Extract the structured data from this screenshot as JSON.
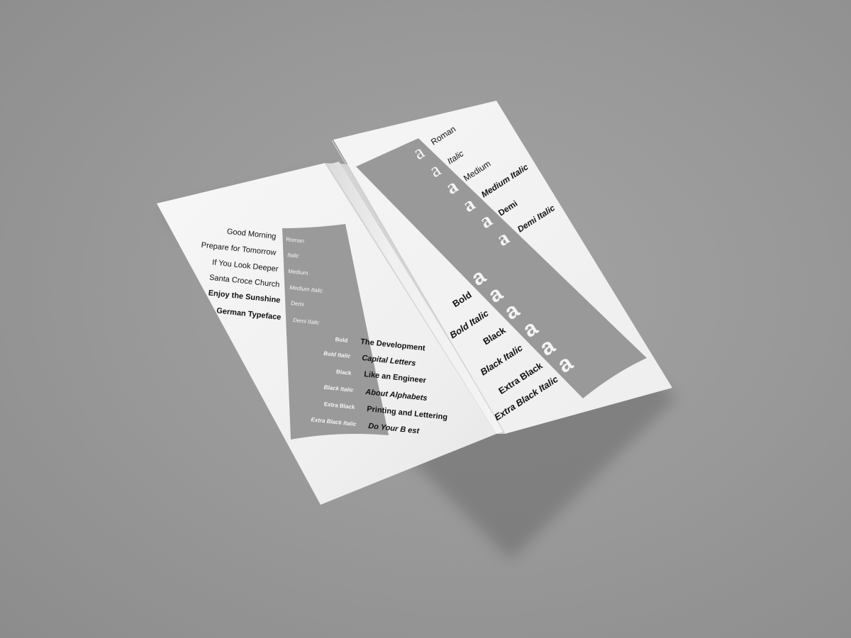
{
  "colors": {
    "background": "#9b9b9b",
    "paper": "#f2f2f2",
    "band": "#999999",
    "ink": "#111111",
    "band_text": "#f5f5f5"
  },
  "left_panel": {
    "phrases_left": [
      "Good Morning",
      "Prepare for Tomorrow",
      "If You Look Deeper",
      "Santa Croce Church",
      "Enjoy the Sunshine",
      "German Typeface"
    ],
    "band_weights_top": [
      "Roman",
      "Italic",
      "Medium",
      "Medium Italic",
      "Demi",
      "Demi Italic"
    ],
    "band_weights_bottom": [
      "Bold",
      "Bold Italic",
      "Black",
      "Black Italic",
      "Extra Black",
      "Extra Black Italic"
    ],
    "phrases_right": [
      "The Development",
      "Capital Letters",
      "Like an Engineer",
      "About Alphabets",
      "Printing and Lettering",
      "Do Your B est"
    ]
  },
  "right_panel": {
    "glyph": "a",
    "weights_top": [
      "Roman",
      "Italic",
      "Medium",
      "Medium Italic",
      "Demi",
      "Demi Italic"
    ],
    "weights_bottom": [
      "Bold",
      "Bold Italic",
      "Black",
      "Black Italic",
      "Extra Black",
      "Extra Black Italic"
    ]
  }
}
